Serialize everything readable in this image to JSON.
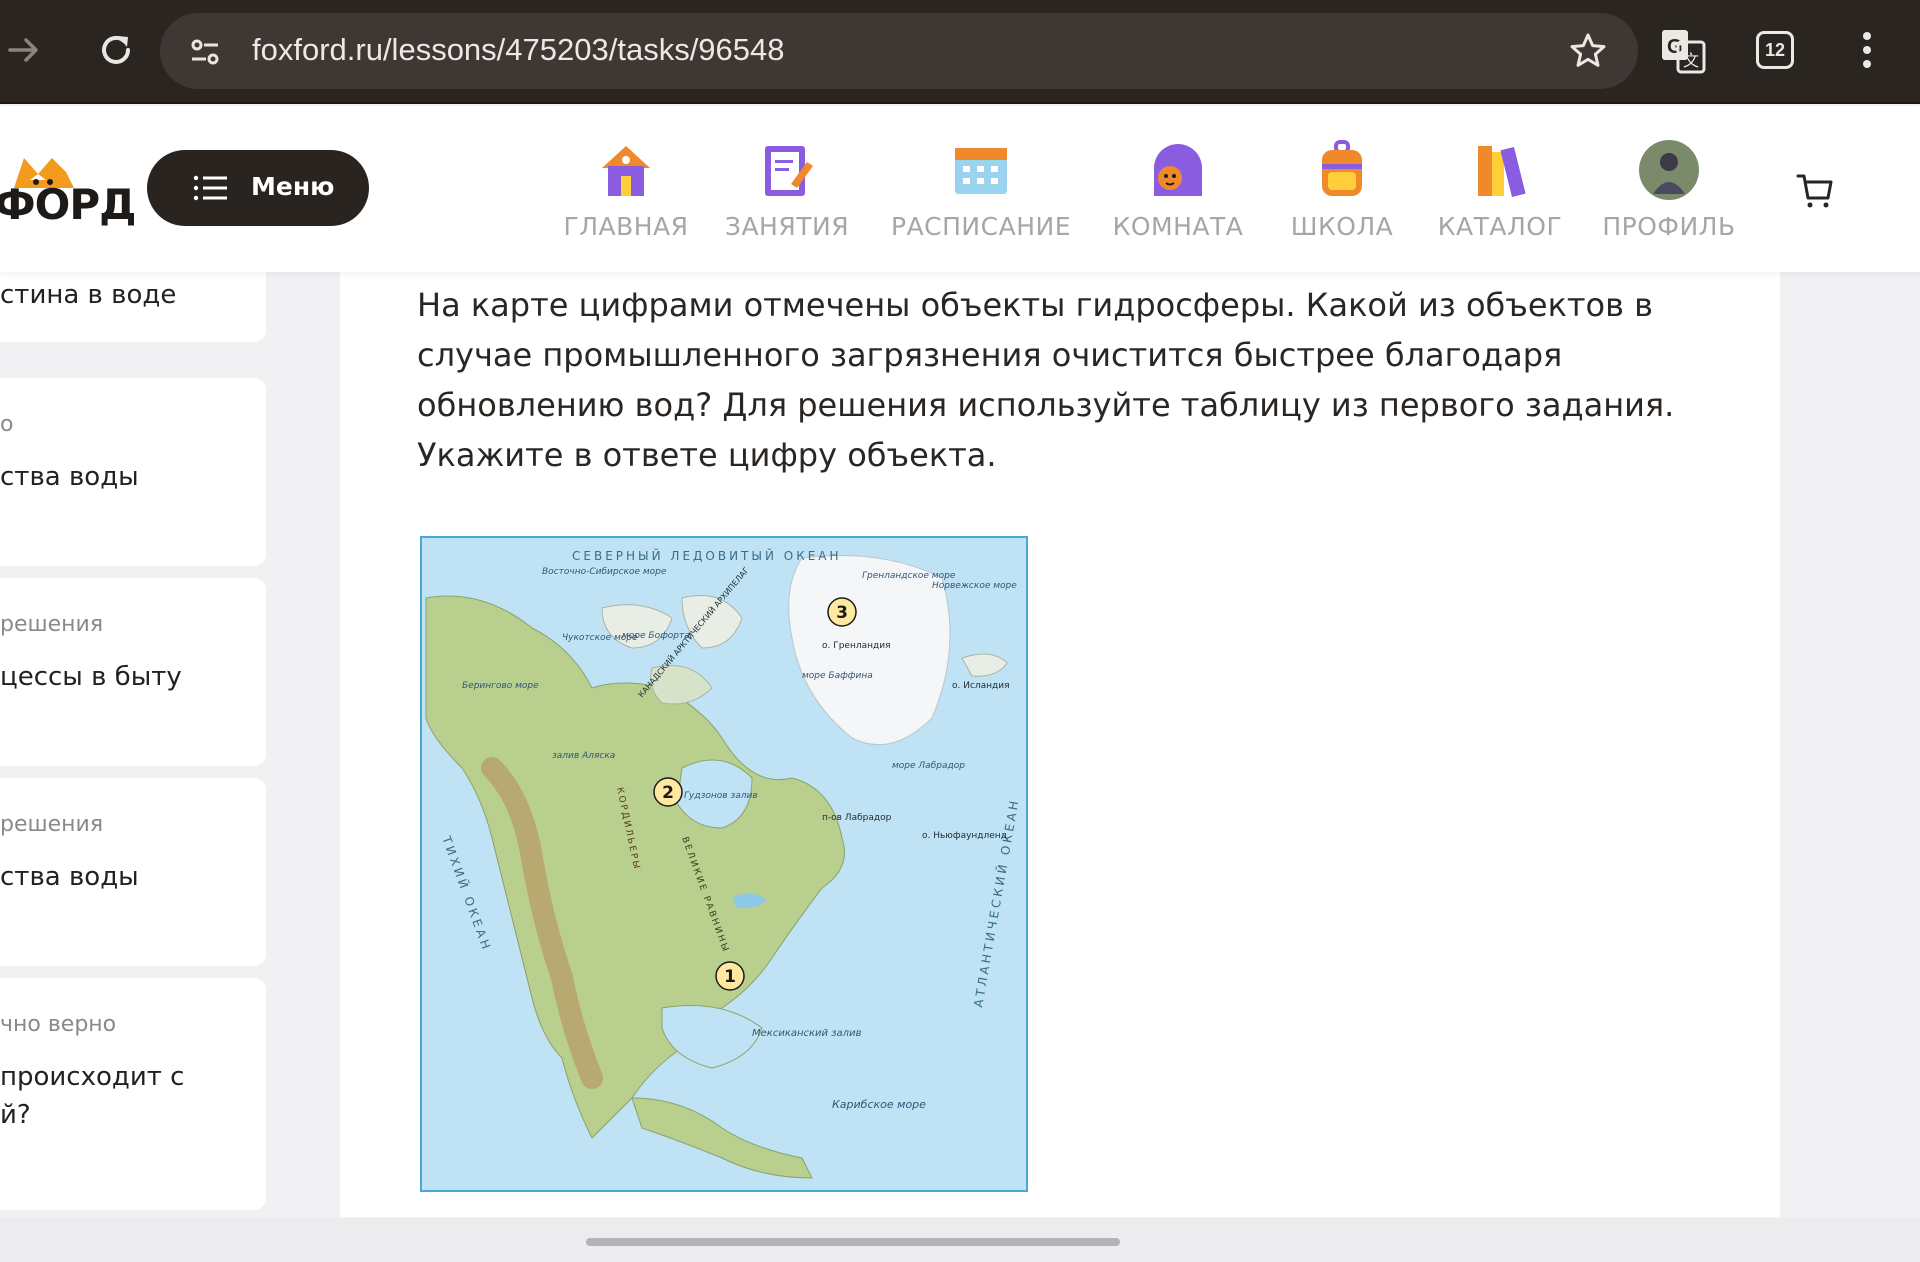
{
  "browser": {
    "url": "foxford.ru/lessons/475203/tasks/96548",
    "tab_count": "12"
  },
  "header": {
    "logo_text": "ФОРД",
    "menu_label": "Меню",
    "nav": [
      {
        "label": "ГЛАВНАЯ",
        "icon": "house-icon"
      },
      {
        "label": "ЗАНЯТИЯ",
        "icon": "notebook-pencil-icon"
      },
      {
        "label": "РАСПИСАНИЕ",
        "icon": "calendar-icon"
      },
      {
        "label": "КОМНАТА",
        "icon": "fox-avatar-icon"
      },
      {
        "label": "ШКОЛА",
        "icon": "backpack-icon"
      },
      {
        "label": "КАТАЛОГ",
        "icon": "books-icon"
      },
      {
        "label": "ПРОФИЛЬ",
        "icon": "profile-avatar-icon"
      }
    ]
  },
  "sidebar": {
    "cards": [
      {
        "meta": "",
        "title_lines": [
          "стина в воде"
        ]
      },
      {
        "meta": "о",
        "title_lines": [
          "ства воды"
        ]
      },
      {
        "meta": "решения",
        "title_lines": [
          "цессы в быту"
        ]
      },
      {
        "meta": "решения",
        "title_lines": [
          "ства воды"
        ]
      },
      {
        "meta": "чно верно",
        "title_lines": [
          "происходит с",
          "й?"
        ]
      }
    ]
  },
  "task": {
    "question_lines": [
      "На карте цифрами отмечены объекты гидросферы. Какой из объектов в",
      "случае промышленного загрязнения очистится быстрее благодаря",
      "обновлению вод? Для решения используйте таблицу из первого задания.",
      "Укажите в ответе цифру объекта."
    ]
  },
  "map": {
    "labels": {
      "arctic_ocean": "СЕВЕРНЫЙ ЛЕДОВИТЫЙ ОКЕАН",
      "east_siberian_sea": "Восточно-Сибирское море",
      "chukchi_sea": "Чукотское море",
      "beaufort_sea": "море Бофорта",
      "bering_sea": "Берингово море",
      "alaska_gulf": "залив Аляска",
      "greenland_sea": "Гренландское море",
      "norwegian_sea": "Норвежское море",
      "greenland": "о. Гренландия",
      "baffin_sea": "море Баффина",
      "hudson_bay": "Гудзонов залив",
      "labrador_sea": "море Лабрадор",
      "labrador_pen": "п-ов Лабрадор",
      "iceland": "о. Исландия",
      "newfoundland": "о. Ньюфаундленд",
      "mexican_gulf": "Мексиканский залив",
      "caribbean_sea": "Карибское море",
      "pacific_ocean": "ТИХИЙ ОКЕАН",
      "atlantic_ocean": "АТЛАНТИЧЕСКИЙ ОКЕАН",
      "canadian_arch": "КАНАДСКИЙ АРКТИЧЕСКИЙ АРХИПЕЛАГ",
      "cordillera": "КОРДИЛЬЕРЫ",
      "great_plains": "ВЕЛИКИЕ РАВНИНЫ"
    },
    "markers": [
      "1",
      "2",
      "3"
    ]
  }
}
